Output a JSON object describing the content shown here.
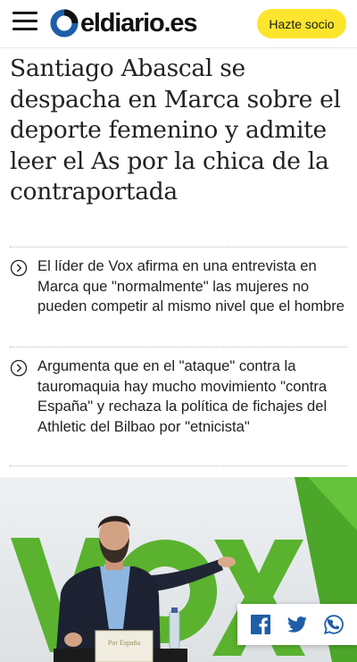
{
  "header": {
    "menu_icon": "hamburger-menu-icon",
    "logo_text": "eldiario.es",
    "cta_label": "Hazte socio",
    "cta_color": "#fde52d"
  },
  "article": {
    "headline": "Santiago Abascal se despacha en Marca sobre el deporte femenino y admite leer el As por la chica de la contraportada",
    "summary": [
      "El líder de Vox afirma en una entrevista en Marca que \"normalmente\" las mujeres no pueden competir al mismo nivel que el hombre",
      "Argumenta que en el \"ataque\" contra la tauromaquia hay mucho movimiento \"contra España\" y rechaza la política de fichajes del Athletic del Bilbao por \"etnicista\""
    ],
    "photo": {
      "backdrop_text": "VOX",
      "backdrop_color": "#5ab22f",
      "lectern_text": "Por España"
    }
  },
  "share": {
    "icons": [
      "facebook-icon",
      "twitter-icon",
      "whatsapp-icon"
    ],
    "color": "#1e5ea8"
  }
}
